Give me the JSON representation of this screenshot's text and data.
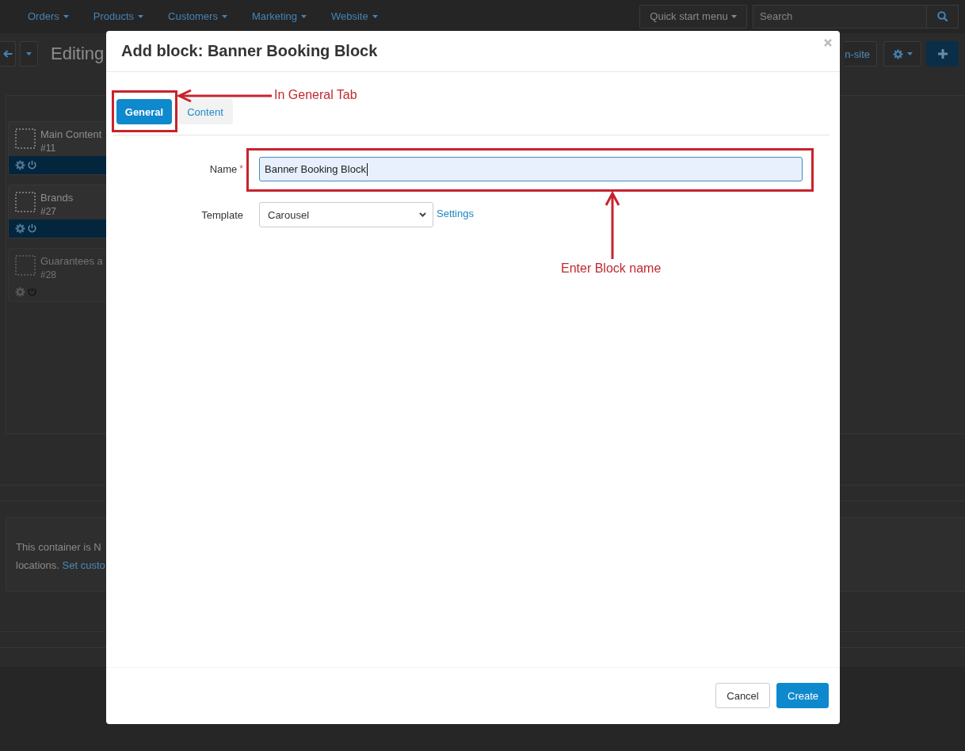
{
  "topbar": {
    "menu": [
      {
        "label": "Orders"
      },
      {
        "label": "Products"
      },
      {
        "label": "Customers"
      },
      {
        "label": "Marketing"
      },
      {
        "label": "Website"
      }
    ],
    "quick_start": "Quick start menu",
    "search": {
      "placeholder": "Search"
    }
  },
  "toolbar": {
    "title": "Editing",
    "view_button": "n-site"
  },
  "blocks": [
    {
      "name": "Main Content",
      "id": "#11",
      "enabled": true
    },
    {
      "name": "Brands",
      "id": "#27",
      "enabled": true
    },
    {
      "name": "Guarantees a",
      "id": "#28",
      "enabled": false
    }
  ],
  "notice": {
    "line_1": "This container is N",
    "line_2": "locations.",
    "link": "Set custo"
  },
  "modal": {
    "title": "Add block: Banner Booking Block",
    "tabs": [
      {
        "label": "General",
        "selected": true
      },
      {
        "label": "Content",
        "selected": false
      }
    ],
    "fields": [
      {
        "kind": "text",
        "label": "Name",
        "required_mark": "*",
        "value": "Banner Booking Block",
        "focused": true
      },
      {
        "kind": "select",
        "label": "Template",
        "value": "Carousel",
        "link": "Settings"
      }
    ],
    "buttons": [
      {
        "label": "Cancel",
        "kind": "secondary"
      },
      {
        "label": "Create",
        "kind": "primary"
      }
    ]
  },
  "annotations": [
    {
      "kind": "arrow_left",
      "label": "In General Tab"
    },
    {
      "kind": "arrow_up",
      "label": "Enter Block name"
    }
  ]
}
